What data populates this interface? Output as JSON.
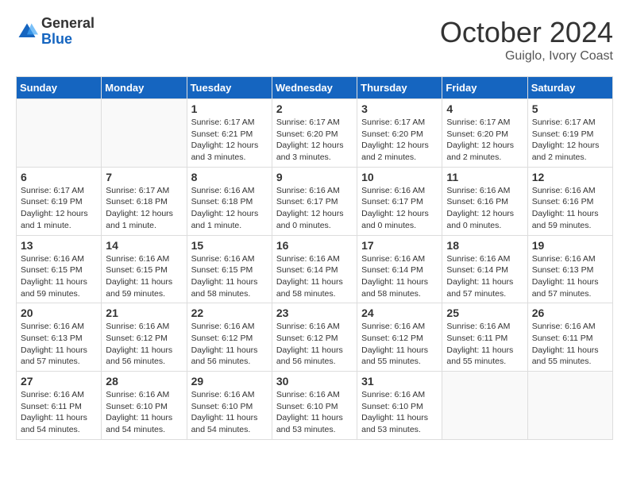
{
  "header": {
    "logo_general": "General",
    "logo_blue": "Blue",
    "month_title": "October 2024",
    "subtitle": "Guiglo, Ivory Coast"
  },
  "days_of_week": [
    "Sunday",
    "Monday",
    "Tuesday",
    "Wednesday",
    "Thursday",
    "Friday",
    "Saturday"
  ],
  "weeks": [
    [
      {
        "day": "",
        "info": ""
      },
      {
        "day": "",
        "info": ""
      },
      {
        "day": "1",
        "info": "Sunrise: 6:17 AM\nSunset: 6:21 PM\nDaylight: 12 hours and 3 minutes."
      },
      {
        "day": "2",
        "info": "Sunrise: 6:17 AM\nSunset: 6:20 PM\nDaylight: 12 hours and 3 minutes."
      },
      {
        "day": "3",
        "info": "Sunrise: 6:17 AM\nSunset: 6:20 PM\nDaylight: 12 hours and 2 minutes."
      },
      {
        "day": "4",
        "info": "Sunrise: 6:17 AM\nSunset: 6:20 PM\nDaylight: 12 hours and 2 minutes."
      },
      {
        "day": "5",
        "info": "Sunrise: 6:17 AM\nSunset: 6:19 PM\nDaylight: 12 hours and 2 minutes."
      }
    ],
    [
      {
        "day": "6",
        "info": "Sunrise: 6:17 AM\nSunset: 6:19 PM\nDaylight: 12 hours and 1 minute."
      },
      {
        "day": "7",
        "info": "Sunrise: 6:17 AM\nSunset: 6:18 PM\nDaylight: 12 hours and 1 minute."
      },
      {
        "day": "8",
        "info": "Sunrise: 6:16 AM\nSunset: 6:18 PM\nDaylight: 12 hours and 1 minute."
      },
      {
        "day": "9",
        "info": "Sunrise: 6:16 AM\nSunset: 6:17 PM\nDaylight: 12 hours and 0 minutes."
      },
      {
        "day": "10",
        "info": "Sunrise: 6:16 AM\nSunset: 6:17 PM\nDaylight: 12 hours and 0 minutes."
      },
      {
        "day": "11",
        "info": "Sunrise: 6:16 AM\nSunset: 6:16 PM\nDaylight: 12 hours and 0 minutes."
      },
      {
        "day": "12",
        "info": "Sunrise: 6:16 AM\nSunset: 6:16 PM\nDaylight: 11 hours and 59 minutes."
      }
    ],
    [
      {
        "day": "13",
        "info": "Sunrise: 6:16 AM\nSunset: 6:15 PM\nDaylight: 11 hours and 59 minutes."
      },
      {
        "day": "14",
        "info": "Sunrise: 6:16 AM\nSunset: 6:15 PM\nDaylight: 11 hours and 59 minutes."
      },
      {
        "day": "15",
        "info": "Sunrise: 6:16 AM\nSunset: 6:15 PM\nDaylight: 11 hours and 58 minutes."
      },
      {
        "day": "16",
        "info": "Sunrise: 6:16 AM\nSunset: 6:14 PM\nDaylight: 11 hours and 58 minutes."
      },
      {
        "day": "17",
        "info": "Sunrise: 6:16 AM\nSunset: 6:14 PM\nDaylight: 11 hours and 58 minutes."
      },
      {
        "day": "18",
        "info": "Sunrise: 6:16 AM\nSunset: 6:14 PM\nDaylight: 11 hours and 57 minutes."
      },
      {
        "day": "19",
        "info": "Sunrise: 6:16 AM\nSunset: 6:13 PM\nDaylight: 11 hours and 57 minutes."
      }
    ],
    [
      {
        "day": "20",
        "info": "Sunrise: 6:16 AM\nSunset: 6:13 PM\nDaylight: 11 hours and 57 minutes."
      },
      {
        "day": "21",
        "info": "Sunrise: 6:16 AM\nSunset: 6:12 PM\nDaylight: 11 hours and 56 minutes."
      },
      {
        "day": "22",
        "info": "Sunrise: 6:16 AM\nSunset: 6:12 PM\nDaylight: 11 hours and 56 minutes."
      },
      {
        "day": "23",
        "info": "Sunrise: 6:16 AM\nSunset: 6:12 PM\nDaylight: 11 hours and 56 minutes."
      },
      {
        "day": "24",
        "info": "Sunrise: 6:16 AM\nSunset: 6:12 PM\nDaylight: 11 hours and 55 minutes."
      },
      {
        "day": "25",
        "info": "Sunrise: 6:16 AM\nSunset: 6:11 PM\nDaylight: 11 hours and 55 minutes."
      },
      {
        "day": "26",
        "info": "Sunrise: 6:16 AM\nSunset: 6:11 PM\nDaylight: 11 hours and 55 minutes."
      }
    ],
    [
      {
        "day": "27",
        "info": "Sunrise: 6:16 AM\nSunset: 6:11 PM\nDaylight: 11 hours and 54 minutes."
      },
      {
        "day": "28",
        "info": "Sunrise: 6:16 AM\nSunset: 6:10 PM\nDaylight: 11 hours and 54 minutes."
      },
      {
        "day": "29",
        "info": "Sunrise: 6:16 AM\nSunset: 6:10 PM\nDaylight: 11 hours and 54 minutes."
      },
      {
        "day": "30",
        "info": "Sunrise: 6:16 AM\nSunset: 6:10 PM\nDaylight: 11 hours and 53 minutes."
      },
      {
        "day": "31",
        "info": "Sunrise: 6:16 AM\nSunset: 6:10 PM\nDaylight: 11 hours and 53 minutes."
      },
      {
        "day": "",
        "info": ""
      },
      {
        "day": "",
        "info": ""
      }
    ]
  ]
}
